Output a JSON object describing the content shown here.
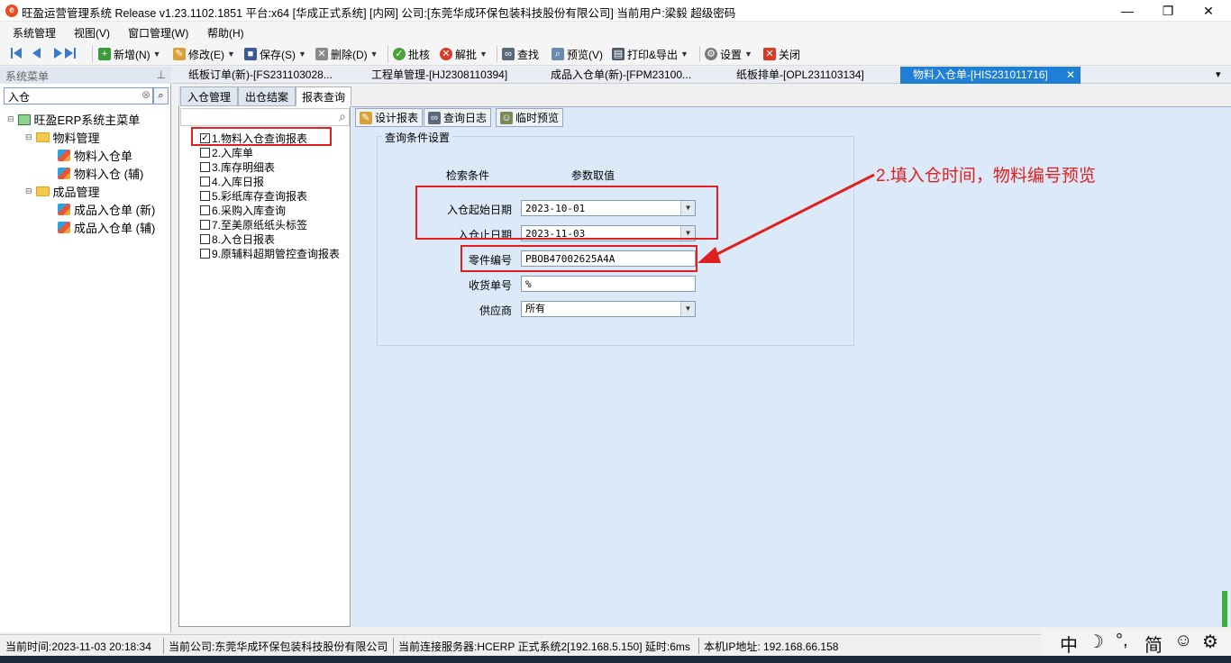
{
  "titlebar": {
    "title": "旺盈运营管理系统 Release v1.23.1102.1851 平台:x64  [华成正式系统] [内网] 公司:[东莞华成环保包装科技股份有限公司] 当前用户:梁毅  超级密码",
    "minimize": "—",
    "restore": "❐",
    "close": "✕"
  },
  "menubar": {
    "items": [
      "系统管理",
      "视图(V)",
      "窗口管理(W)",
      "帮助(H)"
    ]
  },
  "toolbar": {
    "new": "新增(N)",
    "edit": "修改(E)",
    "save": "保存(S)",
    "delete": "删除(D)",
    "approve": "批核",
    "unapprove": "解批",
    "find": "查找",
    "preview": "预览(V)",
    "print": "打印&导出",
    "settings": "设置",
    "close": "关闭"
  },
  "sidebar": {
    "header": "系统菜单",
    "pin": "⊥",
    "search_value": "入仓",
    "clear": "⊗",
    "search_btn": "⌕",
    "tree": {
      "root": "旺盈ERP系统主菜单",
      "folder1": "物料管理",
      "item1a": "物料入仓单",
      "item1b": "物料入仓 (辅)",
      "folder2": "成品管理",
      "item2a": "成品入仓单 (新)",
      "item2b": "成品入仓单 (辅)"
    }
  },
  "tabs": [
    "纸板订单(新)-[FS231103028...",
    "工程单管理-[HJ2308110394]",
    "成品入仓单(新)-[FPM23100...",
    "纸板排单-[OPL231103134]",
    "物料入仓单-[HIS231011716]"
  ],
  "tab_close": "✕",
  "tab_menu": "▾",
  "left_panel": {
    "tabs": [
      "入仓管理",
      "出仓结案",
      "报表查询"
    ],
    "search_icon": "⌕",
    "reports": [
      "1.物料入仓查询报表",
      "2.入库单",
      "3.库存明细表",
      "4.入库日报",
      "5.彩纸库存查询报表",
      "6.采购入库查询",
      "7.至美原纸纸头标签",
      "8.入仓日报表",
      "9.原辅料超期管控查询报表"
    ],
    "checked_index": 0,
    "check_mark": "✓"
  },
  "right_panel": {
    "buttons": [
      "设计报表",
      "查询日志",
      "临时预览"
    ],
    "group_title": "查询条件设置",
    "col_condition": "检索条件",
    "col_value": "参数取值",
    "fields": {
      "start_label": "入仓起始日期",
      "start_value": "2023-10-01",
      "end_label": "入仓止日期",
      "end_value": "2023-11-03",
      "part_label": "零件编号",
      "part_value": "PBOB47002625A4A",
      "receipt_label": "收货单号",
      "receipt_value": "%",
      "supplier_label": "供应商",
      "supplier_value": "所有"
    },
    "dropdown_arrow": "▼"
  },
  "annotation": "2.填入仓时间，物料编号预览",
  "statusbar": {
    "time": "当前时间:2023-11-03 20:18:34",
    "company": "当前公司:东莞华成环保包装科技股份有限公司",
    "server": "当前连接服务器:HCERP 正式系统2[192.168.5.150] 延时:6ms",
    "ip": "本机IP地址: 192.168.66.158"
  },
  "ime": [
    "中",
    "☽",
    "°,",
    "简",
    "☺",
    "⚙"
  ],
  "colors": {
    "active_tab": "#1f7fd4",
    "panel_bg": "#dce9f8",
    "annotation_red": "#e02020"
  }
}
